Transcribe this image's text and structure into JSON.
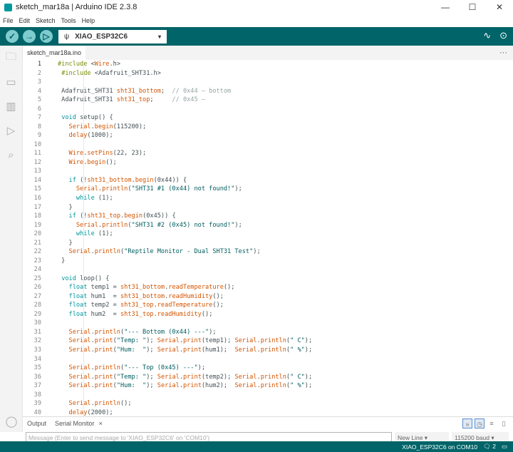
{
  "window": {
    "title": "sketch_mar18a | Arduino IDE 2.3.8",
    "minimize": "—",
    "maximize": "☐",
    "close": "✕"
  },
  "menu": [
    "File",
    "Edit",
    "Sketch",
    "Tools",
    "Help"
  ],
  "toolbar": {
    "verify": "✓",
    "upload": "→",
    "debug": "▷",
    "board": "XIAO_ESP32C6",
    "usb_icon": "ψ",
    "caret": "▾",
    "plotter": "∿",
    "monitor": "⊙"
  },
  "tab": {
    "label": "sketch_mar18a.ino",
    "more": "···"
  },
  "code": [
    "#include <Wire.h>",
    " #include <Adafruit_SHT31.h>",
    "",
    " Adafruit_SHT31 sht31_bottom;  // 0x44 — bottom",
    " Adafruit_SHT31 sht31_top;     // 0x45 —",
    "",
    " void setup() {",
    "   Serial.begin(115200);",
    "   delay(1000);",
    "",
    "   Wire.setPins(22, 23);",
    "   Wire.begin();",
    "",
    "   if (!sht31_bottom.begin(0x44)) {",
    "     Serial.println(\"SHT31 #1 (0x44) not found!\");",
    "     while (1);",
    "   }",
    "   if (!sht31_top.begin(0x45)) {",
    "     Serial.println(\"SHT31 #2 (0x45) not found!\");",
    "     while (1);",
    "   }",
    "   Serial.println(\"Reptile Monitor - Dual SHT31 Test\");",
    " }",
    "",
    " void loop() {",
    "   float temp1 = sht31_bottom.readTemperature();",
    "   float hum1  = sht31_bottom.readHumidity();",
    "   float temp2 = sht31_top.readTemperature();",
    "   float hum2  = sht31_top.readHumidity();",
    "",
    "   Serial.println(\"--- Bottom (0x44) ---\");",
    "   Serial.print(\"Temp: \"); Serial.print(temp1); Serial.println(\" C\");",
    "   Serial.print(\"Hum:  \"); Serial.print(hum1);  Serial.println(\" %\");",
    "",
    "   Serial.println(\"--- Top (0x45) ---\");",
    "   Serial.print(\"Temp: \"); Serial.print(temp2); Serial.println(\" C\");",
    "   Serial.print(\"Hum:  \"); Serial.print(hum2);  Serial.println(\" %\");",
    "",
    "   Serial.println();",
    "   delay(2000);"
  ],
  "bottom": {
    "output_tab": "Output",
    "serial_tab": "Serial Monitor",
    "close": "×",
    "placeholder": "Message (Enter to send message to 'XIAO_ESP32C6' on 'COM10')",
    "line_ending": "New Line",
    "baud": "115200 baud",
    "autoscroll": "»",
    "timestamp": "◷",
    "clear": "≡",
    "copy": "▯"
  },
  "status": {
    "board_port": "XIAO_ESP32C6 on COM10",
    "notifications": "2",
    "notif_icon": "🗨",
    "panel_icon": "▭"
  }
}
